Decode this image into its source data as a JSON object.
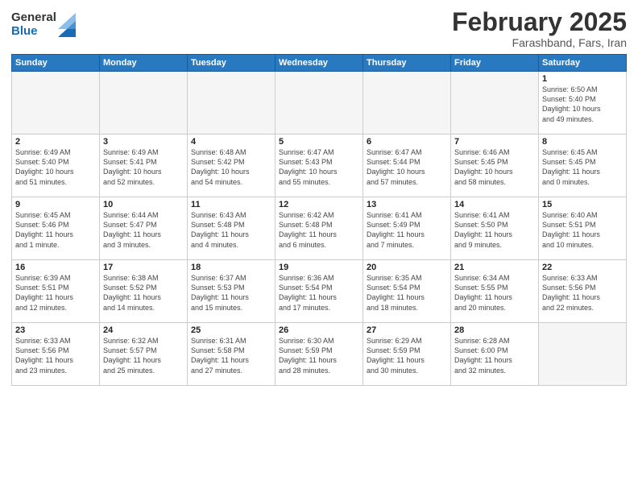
{
  "header": {
    "logo_general": "General",
    "logo_blue": "Blue",
    "month_title": "February 2025",
    "location": "Farashband, Fars, Iran"
  },
  "calendar": {
    "days_of_week": [
      "Sunday",
      "Monday",
      "Tuesday",
      "Wednesday",
      "Thursday",
      "Friday",
      "Saturday"
    ],
    "weeks": [
      [
        {
          "day": "",
          "info": ""
        },
        {
          "day": "",
          "info": ""
        },
        {
          "day": "",
          "info": ""
        },
        {
          "day": "",
          "info": ""
        },
        {
          "day": "",
          "info": ""
        },
        {
          "day": "",
          "info": ""
        },
        {
          "day": "1",
          "info": "Sunrise: 6:50 AM\nSunset: 5:40 PM\nDaylight: 10 hours\nand 49 minutes."
        }
      ],
      [
        {
          "day": "2",
          "info": "Sunrise: 6:49 AM\nSunset: 5:40 PM\nDaylight: 10 hours\nand 51 minutes."
        },
        {
          "day": "3",
          "info": "Sunrise: 6:49 AM\nSunset: 5:41 PM\nDaylight: 10 hours\nand 52 minutes."
        },
        {
          "day": "4",
          "info": "Sunrise: 6:48 AM\nSunset: 5:42 PM\nDaylight: 10 hours\nand 54 minutes."
        },
        {
          "day": "5",
          "info": "Sunrise: 6:47 AM\nSunset: 5:43 PM\nDaylight: 10 hours\nand 55 minutes."
        },
        {
          "day": "6",
          "info": "Sunrise: 6:47 AM\nSunset: 5:44 PM\nDaylight: 10 hours\nand 57 minutes."
        },
        {
          "day": "7",
          "info": "Sunrise: 6:46 AM\nSunset: 5:45 PM\nDaylight: 10 hours\nand 58 minutes."
        },
        {
          "day": "8",
          "info": "Sunrise: 6:45 AM\nSunset: 5:45 PM\nDaylight: 11 hours\nand 0 minutes."
        }
      ],
      [
        {
          "day": "9",
          "info": "Sunrise: 6:45 AM\nSunset: 5:46 PM\nDaylight: 11 hours\nand 1 minute."
        },
        {
          "day": "10",
          "info": "Sunrise: 6:44 AM\nSunset: 5:47 PM\nDaylight: 11 hours\nand 3 minutes."
        },
        {
          "day": "11",
          "info": "Sunrise: 6:43 AM\nSunset: 5:48 PM\nDaylight: 11 hours\nand 4 minutes."
        },
        {
          "day": "12",
          "info": "Sunrise: 6:42 AM\nSunset: 5:48 PM\nDaylight: 11 hours\nand 6 minutes."
        },
        {
          "day": "13",
          "info": "Sunrise: 6:41 AM\nSunset: 5:49 PM\nDaylight: 11 hours\nand 7 minutes."
        },
        {
          "day": "14",
          "info": "Sunrise: 6:41 AM\nSunset: 5:50 PM\nDaylight: 11 hours\nand 9 minutes."
        },
        {
          "day": "15",
          "info": "Sunrise: 6:40 AM\nSunset: 5:51 PM\nDaylight: 11 hours\nand 10 minutes."
        }
      ],
      [
        {
          "day": "16",
          "info": "Sunrise: 6:39 AM\nSunset: 5:51 PM\nDaylight: 11 hours\nand 12 minutes."
        },
        {
          "day": "17",
          "info": "Sunrise: 6:38 AM\nSunset: 5:52 PM\nDaylight: 11 hours\nand 14 minutes."
        },
        {
          "day": "18",
          "info": "Sunrise: 6:37 AM\nSunset: 5:53 PM\nDaylight: 11 hours\nand 15 minutes."
        },
        {
          "day": "19",
          "info": "Sunrise: 6:36 AM\nSunset: 5:54 PM\nDaylight: 11 hours\nand 17 minutes."
        },
        {
          "day": "20",
          "info": "Sunrise: 6:35 AM\nSunset: 5:54 PM\nDaylight: 11 hours\nand 18 minutes."
        },
        {
          "day": "21",
          "info": "Sunrise: 6:34 AM\nSunset: 5:55 PM\nDaylight: 11 hours\nand 20 minutes."
        },
        {
          "day": "22",
          "info": "Sunrise: 6:33 AM\nSunset: 5:56 PM\nDaylight: 11 hours\nand 22 minutes."
        }
      ],
      [
        {
          "day": "23",
          "info": "Sunrise: 6:33 AM\nSunset: 5:56 PM\nDaylight: 11 hours\nand 23 minutes."
        },
        {
          "day": "24",
          "info": "Sunrise: 6:32 AM\nSunset: 5:57 PM\nDaylight: 11 hours\nand 25 minutes."
        },
        {
          "day": "25",
          "info": "Sunrise: 6:31 AM\nSunset: 5:58 PM\nDaylight: 11 hours\nand 27 minutes."
        },
        {
          "day": "26",
          "info": "Sunrise: 6:30 AM\nSunset: 5:59 PM\nDaylight: 11 hours\nand 28 minutes."
        },
        {
          "day": "27",
          "info": "Sunrise: 6:29 AM\nSunset: 5:59 PM\nDaylight: 11 hours\nand 30 minutes."
        },
        {
          "day": "28",
          "info": "Sunrise: 6:28 AM\nSunset: 6:00 PM\nDaylight: 11 hours\nand 32 minutes."
        },
        {
          "day": "",
          "info": ""
        }
      ]
    ]
  }
}
